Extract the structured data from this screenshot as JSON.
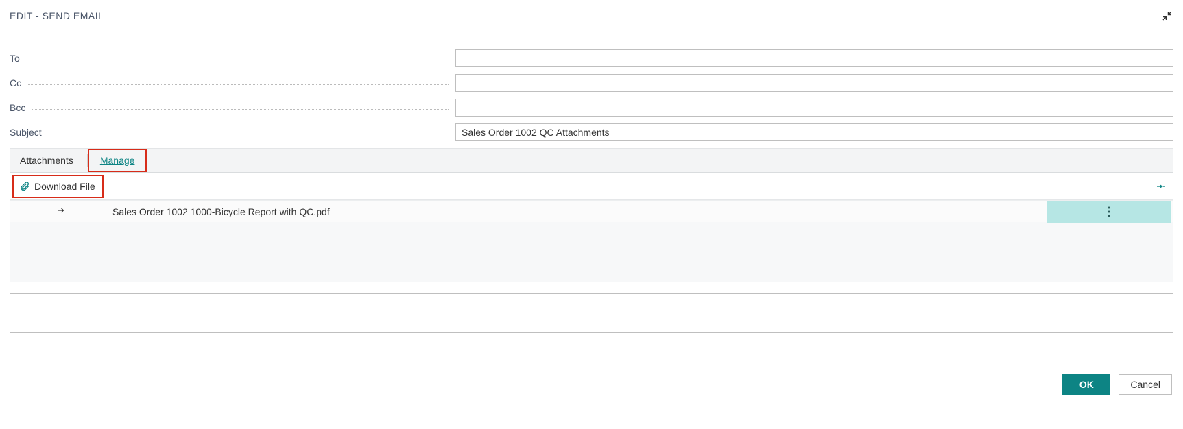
{
  "header": {
    "title": "EDIT - SEND EMAIL"
  },
  "form": {
    "to_label": "To",
    "to_value": "",
    "cc_label": "Cc",
    "cc_value": "",
    "bcc_label": "Bcc",
    "bcc_value": "",
    "subject_label": "Subject",
    "subject_value": "Sales Order 1002 QC Attachments"
  },
  "attachments": {
    "section_label": "Attachments",
    "manage_label": "Manage",
    "download_label": "Download File",
    "files": [
      {
        "name": "Sales Order 1002 1000-Bicycle Report with QC.pdf"
      }
    ]
  },
  "body": {
    "value": ""
  },
  "footer": {
    "ok_label": "OK",
    "cancel_label": "Cancel"
  },
  "colors": {
    "accent": "#0d8484",
    "highlight_border": "#d72c19",
    "row_action_bg": "#b6e6e4"
  }
}
